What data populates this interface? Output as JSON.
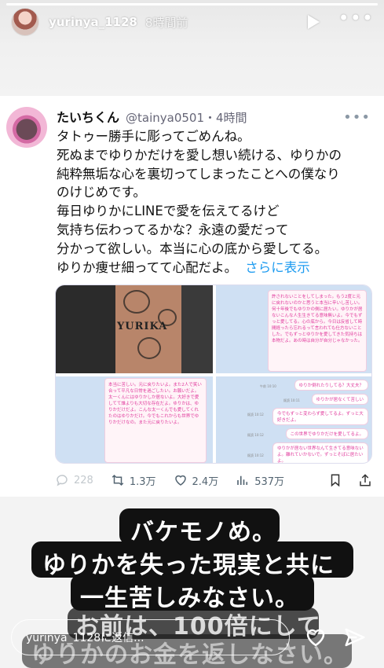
{
  "story": {
    "username": "yurinya_1128",
    "time": "8時間前",
    "progress_fraction": 1.0
  },
  "tweet": {
    "display_name": "たいちくん",
    "handle": "@tainya0501",
    "time": "・4時間",
    "body_lines": [
      "タトゥー勝手に彫ってごめんね。",
      "死ぬまでゆりかだけを愛し想い続ける、ゆりかの",
      "純粋無垢な心を裏切ってしまったことへの僕なり",
      "のけじめです。",
      "毎日ゆりかにLINEで愛を伝えてるけど",
      "気持ち伝わってるかな？永遠の愛だって",
      "分かって欲しい。本当に心の底から愛してる。",
      "ゆりか痩せ細ってて心配だよ。"
    ],
    "see_more": "さらに表示",
    "media": {
      "tattoo_text": "YURIKA",
      "letter_top_right": "許されないことをしてしまった。もう2度と元に戻れないのかと思うと本当に辛いし苦しい。何十年後でもゆりかの側に居たい。ゆりかが居ないこんな人生生きてる意味無いよ。今でもずっと愛してる。心の底から。今日は反省して時間経ったら忘れるって言われても仕方ないことした。でもずっとゆりかを愛してきた気持ちは本物だよ。あの時は自分が自分じゃなかった。",
      "letter_bottom_left": "本当に苦しい。元に戻りたいよ。また2人で笑い合って平凡な日常を過ごしたい。お願いだよ。太一くんにはゆりかしか居ないよ。大好きで愛してて誰よりも大切な存在だよ。ゆりかは、ゆりかだけだよ。こんな太一くんでも愛してくれたのはゆりかだけ。今でもこれからも世界でゆりかだけなの。また元に戻りたいよ。",
      "chat": [
        {
          "text": "ゆりか倒れたりしてる？大丈夫？",
          "time": "午前 10:10"
        },
        {
          "text": "ゆりかが居なくて苦しい",
          "time": "既読 10:11"
        },
        {
          "text": "今でもずっと変わらず愛してるよ。ずっと大好きだよ。",
          "time": "既読 10:12"
        },
        {
          "text": "この世界でゆりかだけを愛してるよ。",
          "time": "既読 10:12"
        },
        {
          "text": "ゆりかが居ない世界なんて生きてる意味ないよ。離れていかないで。ずっとそばに居たいよ。",
          "time": "既読 10:12"
        }
      ]
    },
    "actions": {
      "replies": "228",
      "retweets": "1.3万",
      "likes": "2.4万",
      "views": "537万"
    }
  },
  "caption": {
    "lines": [
      "バケモノめ。",
      "ゆりかを失った現実と共に",
      "一生苦しみなさい。",
      "お前は、100倍にして",
      "ゆりかのお金を返しなさい。"
    ]
  },
  "reply": {
    "placeholder": "yurinya_1128に返信..."
  },
  "colors": {
    "link": "#1d9bf0",
    "caption_bg": "#111111",
    "letter_text": "#e0389b"
  }
}
